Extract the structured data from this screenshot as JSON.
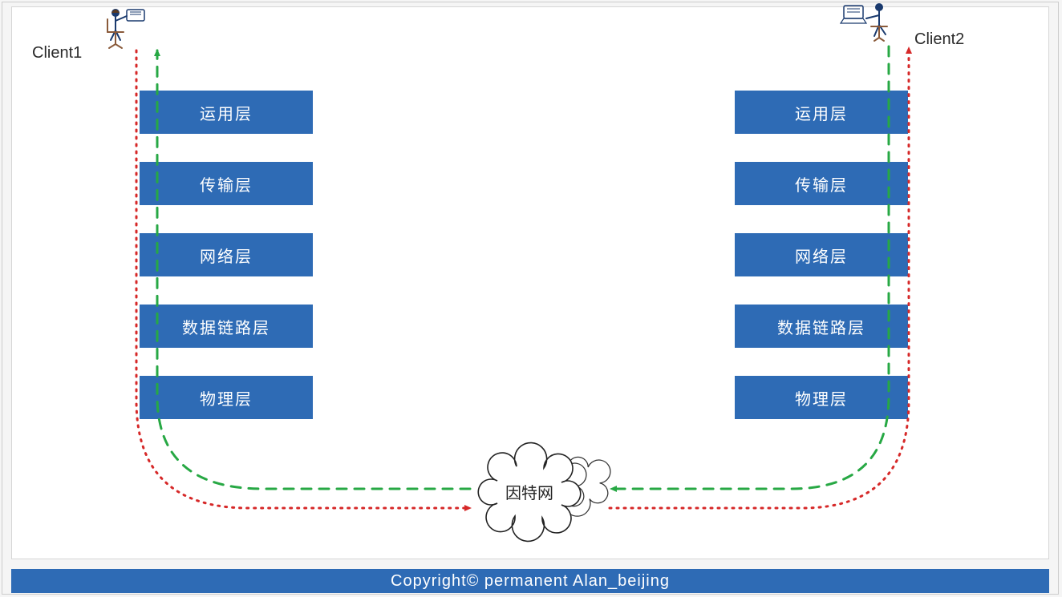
{
  "labels": {
    "client1": "Client1",
    "client2": "Client2"
  },
  "left_stack": {
    "layer1": "运用层",
    "layer2": "传输层",
    "layer3": "网络层",
    "layer4": "数据链路层",
    "layer5": "物理层"
  },
  "right_stack": {
    "layer1": "运用层",
    "layer2": "传输层",
    "layer3": "网络层",
    "layer4": "数据链路层",
    "layer5": "物理层"
  },
  "center": {
    "internet": "因特网"
  },
  "footer": {
    "copyright": "Copyright©  permanent   Alan_beijing"
  }
}
